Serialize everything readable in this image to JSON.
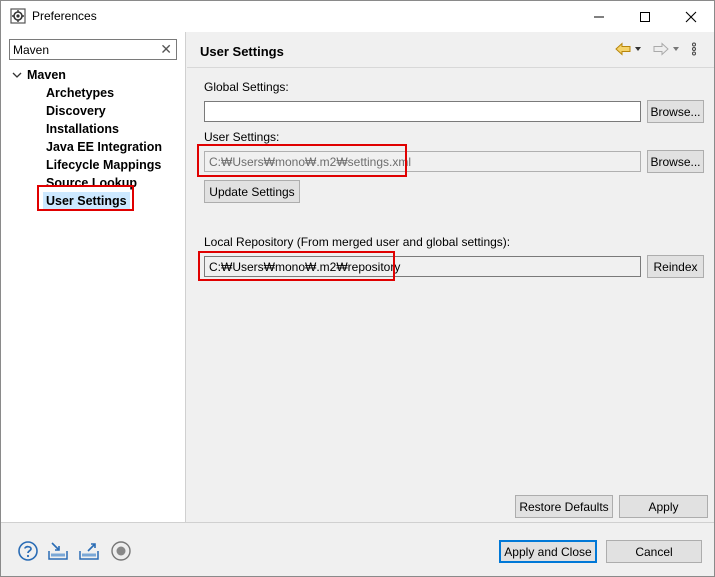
{
  "window": {
    "title": "Preferences",
    "icon": "preferences-gear-icon"
  },
  "filter": {
    "value": "Maven"
  },
  "tree": {
    "root": "Maven",
    "items": [
      {
        "label": "Archetypes"
      },
      {
        "label": "Discovery"
      },
      {
        "label": "Installations"
      },
      {
        "label": "Java EE Integration"
      },
      {
        "label": "Lifecycle Mappings"
      },
      {
        "label": "Source Lookup"
      },
      {
        "label": "User Settings",
        "selected": true
      }
    ]
  },
  "page": {
    "title": "User Settings",
    "global_settings_label": "Global Settings:",
    "global_settings_value": "",
    "browse_label": "Browse...",
    "user_settings_label": "User Settings:",
    "user_settings_value": "C:₩Users₩mono₩.m2₩settings.xml",
    "update_settings_label": "Update Settings",
    "local_repo_label": "Local Repository (From merged user and global settings):",
    "local_repo_value": "C:₩Users₩mono₩.m2₩repository",
    "reindex_label": "Reindex",
    "restore_defaults_label": "Restore Defaults",
    "apply_label": "Apply"
  },
  "footer": {
    "apply_close_label": "Apply and Close",
    "cancel_label": "Cancel",
    "icons": [
      "help-icon",
      "import-icon",
      "export-icon",
      "record-icon"
    ]
  },
  "colors": {
    "highlight_red": "#e00000",
    "selection_bg": "#cce8ff",
    "default_button_border": "#0078d7"
  }
}
